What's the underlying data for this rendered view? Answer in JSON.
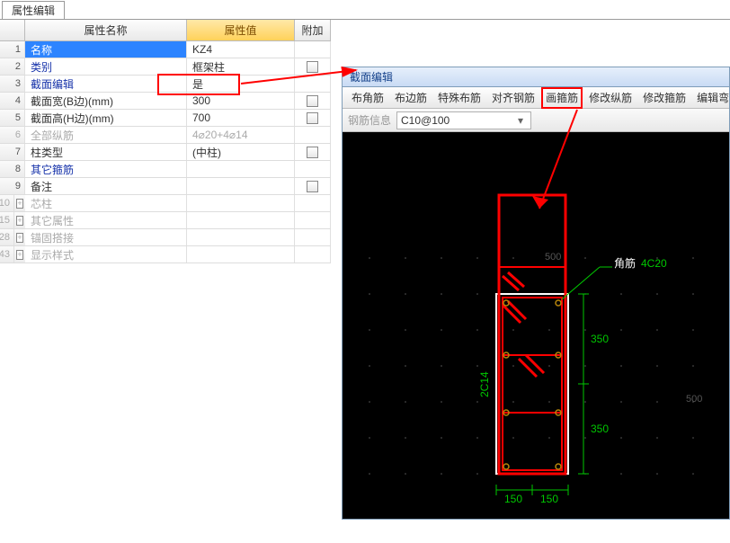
{
  "tab": {
    "label": "属性编辑"
  },
  "grid": {
    "headers": {
      "name": "属性名称",
      "value": "属性值",
      "add": "附加"
    },
    "rows": [
      {
        "n": "1",
        "name": "名称",
        "val": "KZ4",
        "sel": true,
        "add": false
      },
      {
        "n": "2",
        "name": "类别",
        "val": "框架柱",
        "link": true,
        "chk": true
      },
      {
        "n": "3",
        "name": "截面编辑",
        "val": "是",
        "link": true,
        "highlightVal": true
      },
      {
        "n": "4",
        "name": "截面宽(B边)(mm)",
        "val": "300",
        "chk": true
      },
      {
        "n": "5",
        "name": "截面高(H边)(mm)",
        "val": "700",
        "chk": true
      },
      {
        "n": "6",
        "name": "全部纵筋",
        "val": "4⌀20+4⌀14",
        "gray": true,
        "valGhost": true
      },
      {
        "n": "7",
        "name": "柱类型",
        "val": "(中柱)",
        "chk": true
      },
      {
        "n": "8",
        "name": "其它箍筋",
        "val": "",
        "link": true
      },
      {
        "n": "9",
        "name": "备注",
        "val": "",
        "chk": true
      },
      {
        "n": "10",
        "name": "芯柱",
        "val": "",
        "gray": true,
        "tree": true
      },
      {
        "n": "15",
        "name": "其它属性",
        "val": "",
        "gray": true,
        "tree": true
      },
      {
        "n": "28",
        "name": "锚固搭接",
        "val": "",
        "gray": true,
        "tree": true
      },
      {
        "n": "43",
        "name": "显示样式",
        "val": "",
        "gray": true,
        "tree": true
      }
    ]
  },
  "right": {
    "title": "截面编辑",
    "buttons": [
      "布角筋",
      "布边筋",
      "特殊布筋",
      "对齐钢筋",
      "画箍筋",
      "修改纵筋",
      "修改箍筋",
      "编辑弯"
    ],
    "highlight_button_index": 4,
    "subbar": {
      "label": "钢筋信息",
      "combo": "C10@100"
    }
  },
  "section": {
    "outer_label_b": "150",
    "outer_label_b2": "150",
    "outer_label_h1": "350",
    "outer_label_h2": "350",
    "corner_label": "角筋",
    "corner_value": "4C20",
    "side_label": "2C14",
    "tick_500_top": "500",
    "tick_500_bottom": "500"
  }
}
